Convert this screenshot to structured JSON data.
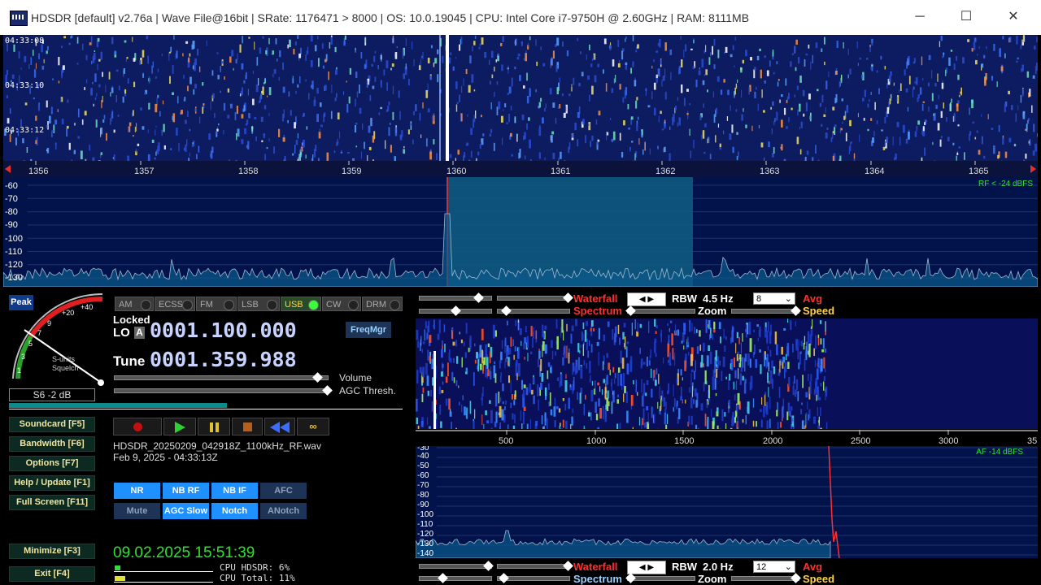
{
  "window": {
    "title": "HDSDR  [default]  v2.76a  |  Wave File@16bit  |  SRate: 1176471 > 8000  |  OS: 10.0.19045    |  CPU: Intel Core i7-9750H @ 2.60GHz  |  RAM: 8111MB",
    "minimize": "─",
    "maximize": "☐",
    "close": "✕"
  },
  "waterfall_top": {
    "timestamps": [
      "04:33:08",
      "04:33:10",
      "04:33:12"
    ]
  },
  "rf_axis": {
    "ticks": [
      "1356",
      "1357",
      "1358",
      "1359",
      "1360",
      "1361",
      "1362",
      "1363",
      "1364",
      "1365"
    ]
  },
  "rf_spectrum": {
    "db_labels": [
      "-60",
      "-70",
      "-80",
      "-90",
      "-100",
      "-110",
      "-120",
      "-130"
    ],
    "level_readout": "RF < -24 dBFS"
  },
  "smeter": {
    "peak_label": "Peak",
    "scale": [
      "1",
      "3",
      "5",
      "7",
      "9",
      "+20",
      "+40"
    ],
    "caption1": "S-units",
    "caption2": "Squelch",
    "reading": "S6 -2 dB"
  },
  "modes": [
    {
      "label": "AM",
      "active": false
    },
    {
      "label": "ECSS",
      "active": false
    },
    {
      "label": "FM",
      "active": false
    },
    {
      "label": "LSB",
      "active": false
    },
    {
      "label": "USB",
      "active": true
    },
    {
      "label": "CW",
      "active": false
    },
    {
      "label": "DRM",
      "active": false
    }
  ],
  "lo": {
    "locked_label": "Locked",
    "lo_label": "LO",
    "lo_bank": "A",
    "lo_freq": "0001.100.000",
    "freqmgr": "FreqMgr"
  },
  "tune": {
    "label": "Tune",
    "freq": "0001.359.988"
  },
  "sliders": {
    "volume_label": "Volume",
    "agc_label": "AGC Thresh."
  },
  "left_buttons": {
    "soundcard": "Soundcard  [F5]",
    "bandwidth": "Bandwidth  [F6]",
    "options": "Options  [F7]",
    "help": "Help / Update  [F1]",
    "fullscreen": "Full Screen  [F11]",
    "minimize": "Minimize  [F3]",
    "exit": "Exit  [F4]"
  },
  "transport": {
    "record_icon": "record-icon",
    "play_icon": "play-icon",
    "pause_icon": "pause-icon",
    "stop_icon": "stop-icon",
    "rewind_icon": "rewind-icon",
    "loop_icon": "loop-icon"
  },
  "file": {
    "name": "HDSDR_20250209_042918Z_1100kHz_RF.wav",
    "date": "Feb 9, 2025 - 04:33:13Z"
  },
  "dsp": [
    {
      "label": "NR",
      "active": true
    },
    {
      "label": "NB RF",
      "active": true
    },
    {
      "label": "NB IF",
      "active": true
    },
    {
      "label": "AFC",
      "active": false
    },
    {
      "label": "Mute",
      "active": false
    },
    {
      "label": "AGC Slow",
      "active": true
    },
    {
      "label": "Notch",
      "active": true
    },
    {
      "label": "ANotch",
      "active": false
    }
  ],
  "status": {
    "datetime": "09.02.2025 15:51:39",
    "cpu_hdsdr": "CPU HDSDR: 6%",
    "cpu_total": "CPU Total: 11%"
  },
  "rf_controls": {
    "waterfall": "Waterfall",
    "spectrum": "Spectrum",
    "rbw_label": "RBW",
    "rbw_value": "4.5 Hz",
    "avg_value": "8",
    "avg_label": "Avg",
    "zoom": "Zoom",
    "speed": "Speed"
  },
  "af_axis": {
    "ticks": [
      "500",
      "1000",
      "1500",
      "2000",
      "2500",
      "3000",
      "35"
    ]
  },
  "af_spectrum": {
    "db_labels": [
      "-30",
      "-40",
      "-50",
      "-60",
      "-70",
      "-80",
      "-90",
      "-100",
      "-110",
      "-120",
      "-130",
      "-140"
    ],
    "level_readout": "AF -14 dBFS"
  },
  "af_controls": {
    "waterfall": "Waterfall",
    "spectrum": "Spectrum",
    "rbw_label": "RBW",
    "rbw_value": "2.0 Hz",
    "avg_value": "12",
    "avg_label": "Avg",
    "zoom": "Zoom",
    "speed": "Speed"
  },
  "colors": {
    "waterfall_bg": "#0d1b60",
    "spectrum_fill": "#0a5a8a",
    "filter_passband": "#0e5a80",
    "mode_active": "#ffd34a",
    "dsp_active": "#1e90ff",
    "freq_digits": "#c8d4ff",
    "status_green": "#30e030"
  }
}
